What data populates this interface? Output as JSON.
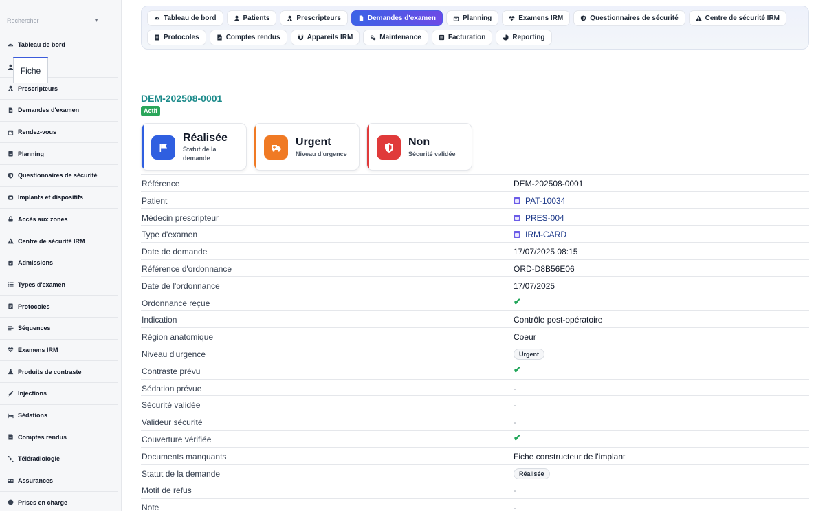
{
  "sidebar": {
    "search_placeholder": "Rechercher",
    "items": [
      {
        "label": "Tableau de bord",
        "icon": "dashboard-icon"
      },
      {
        "label": "Patients",
        "icon": "user-icon"
      },
      {
        "label": "Prescripteurs",
        "icon": "doctor-icon"
      },
      {
        "label": "Demandes d'examen",
        "icon": "file-icon"
      },
      {
        "label": "Rendez-vous",
        "icon": "calendar-icon"
      },
      {
        "label": "Planning",
        "icon": "clipboard-icon"
      },
      {
        "label": "Questionnaires de sécurité",
        "icon": "shield-icon"
      },
      {
        "label": "Implants et dispositifs",
        "icon": "chip-icon"
      },
      {
        "label": "Accès aux zones",
        "icon": "lock-icon"
      },
      {
        "label": "Centre de sécurité IRM",
        "icon": "warning-icon"
      },
      {
        "label": "Admissions",
        "icon": "admission-icon"
      },
      {
        "label": "Types d'examen",
        "icon": "list-icon"
      },
      {
        "label": "Protocoles",
        "icon": "protocol-icon"
      },
      {
        "label": "Séquences",
        "icon": "sequence-icon"
      },
      {
        "label": "Examens IRM",
        "icon": "heartbeat-icon"
      },
      {
        "label": "Produits de contraste",
        "icon": "flask-icon"
      },
      {
        "label": "Injections",
        "icon": "syringe-icon"
      },
      {
        "label": "Sédations",
        "icon": "bed-icon"
      },
      {
        "label": "Comptes rendus",
        "icon": "report-icon"
      },
      {
        "label": "Téléradiologie",
        "icon": "satellite-icon"
      },
      {
        "label": "Assurances",
        "icon": "card-icon"
      },
      {
        "label": "Prises en charge",
        "icon": "circle-icon"
      }
    ]
  },
  "topnav": {
    "row1": [
      {
        "label": "Tableau de bord",
        "icon": "dashboard-icon",
        "active": false
      },
      {
        "label": "Patients",
        "icon": "user-icon",
        "active": false
      },
      {
        "label": "Prescripteurs",
        "icon": "doctor-icon",
        "active": false
      },
      {
        "label": "Demandes d'examen",
        "icon": "file-icon",
        "active": true
      },
      {
        "label": "Planning",
        "icon": "calendar-icon",
        "active": false
      },
      {
        "label": "Examens IRM",
        "icon": "heartbeat-icon",
        "active": false
      },
      {
        "label": "Questionnaires de sécurité",
        "icon": "shield-icon",
        "active": false
      },
      {
        "label": "Centre de sécurité IRM",
        "icon": "warning-icon",
        "active": false
      }
    ],
    "row2": [
      {
        "label": "Protocoles",
        "icon": "protocol-icon",
        "active": false
      },
      {
        "label": "Comptes rendus",
        "icon": "report-icon",
        "active": false
      },
      {
        "label": "Appareils IRM",
        "icon": "magnet-icon",
        "active": false
      },
      {
        "label": "Maintenance",
        "icon": "gears-icon",
        "active": false
      },
      {
        "label": "Facturation",
        "icon": "billing-icon",
        "active": false
      },
      {
        "label": "Reporting",
        "icon": "chart-icon",
        "active": false
      }
    ]
  },
  "tab": {
    "label": "Fiche"
  },
  "record": {
    "id": "DEM-202508-0001",
    "state_badge": "Actif"
  },
  "cards": [
    {
      "value": "Réalisée",
      "caption": "Statut de la demande",
      "color": "#2f5fe0",
      "icon": "flag-icon"
    },
    {
      "value": "Urgent",
      "caption": "Niveau d'urgence",
      "color": "#f07a24",
      "icon": "ambulance-icon"
    },
    {
      "value": "Non",
      "caption": "Sécurité validée",
      "color": "#e03a3a",
      "icon": "shield-icon"
    }
  ],
  "details": [
    {
      "label": "Référence",
      "value": "DEM-202508-0001",
      "kind": "text"
    },
    {
      "label": "Patient",
      "value": "PAT-10034",
      "kind": "link"
    },
    {
      "label": "Médecin prescripteur",
      "value": "PRES-004",
      "kind": "link"
    },
    {
      "label": "Type d'examen",
      "value": "IRM-CARD",
      "kind": "link"
    },
    {
      "label": "Date de demande",
      "value": "17/07/2025 08:15",
      "kind": "text"
    },
    {
      "label": "Référence d'ordonnance",
      "value": "ORD-D8B56E06",
      "kind": "text"
    },
    {
      "label": "Date de l'ordonnance",
      "value": "17/07/2025",
      "kind": "text"
    },
    {
      "label": "Ordonnance reçue",
      "value": "✔",
      "kind": "check"
    },
    {
      "label": "Indication",
      "value": "Contrôle post-opératoire",
      "kind": "text"
    },
    {
      "label": "Région anatomique",
      "value": "Coeur",
      "kind": "text"
    },
    {
      "label": "Niveau d'urgence",
      "value": "Urgent",
      "kind": "chip"
    },
    {
      "label": "Contraste prévu",
      "value": "✔",
      "kind": "check"
    },
    {
      "label": "Sédation prévue",
      "value": "-",
      "kind": "dash"
    },
    {
      "label": "Sécurité validée",
      "value": "-",
      "kind": "dash"
    },
    {
      "label": "Valideur sécurité",
      "value": "-",
      "kind": "dash"
    },
    {
      "label": "Couverture vérifiée",
      "value": "✔",
      "kind": "check"
    },
    {
      "label": "Documents manquants",
      "value": "Fiche constructeur de l'implant",
      "kind": "text"
    },
    {
      "label": "Statut de la demande",
      "value": "Réalisée",
      "kind": "chip"
    },
    {
      "label": "Motif de refus",
      "value": "-",
      "kind": "dash"
    },
    {
      "label": "Note",
      "value": "-",
      "kind": "dash"
    }
  ]
}
